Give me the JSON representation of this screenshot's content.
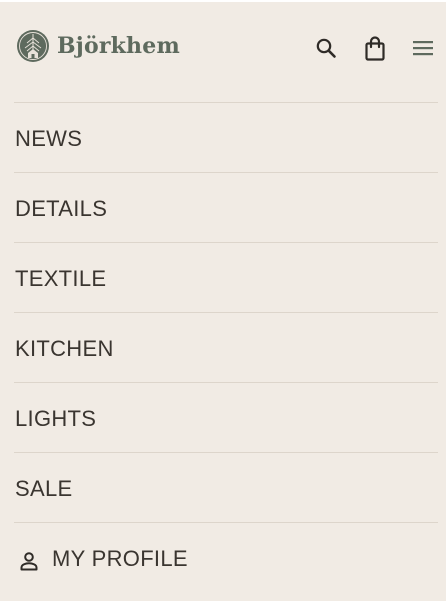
{
  "brand": {
    "name": "Björkhem",
    "logo_icon": "tree-emblem-icon",
    "color": "#5e6a5e"
  },
  "header": {
    "search_icon": "search-icon",
    "bag_icon": "shopping-bag-icon",
    "menu_icon": "hamburger-menu-icon"
  },
  "nav": {
    "items": [
      {
        "label": "NEWS"
      },
      {
        "label": "DETAILS"
      },
      {
        "label": "TEXTILE"
      },
      {
        "label": "KITCHEN"
      },
      {
        "label": "LIGHTS"
      },
      {
        "label": "SALE"
      }
    ],
    "profile": {
      "label": "MY PROFILE",
      "icon": "user-icon"
    }
  },
  "colors": {
    "background": "#f1ebe4",
    "divider": "#ddd5cb",
    "text": "#3a3530",
    "menu_icon": "#5e6a5e"
  }
}
